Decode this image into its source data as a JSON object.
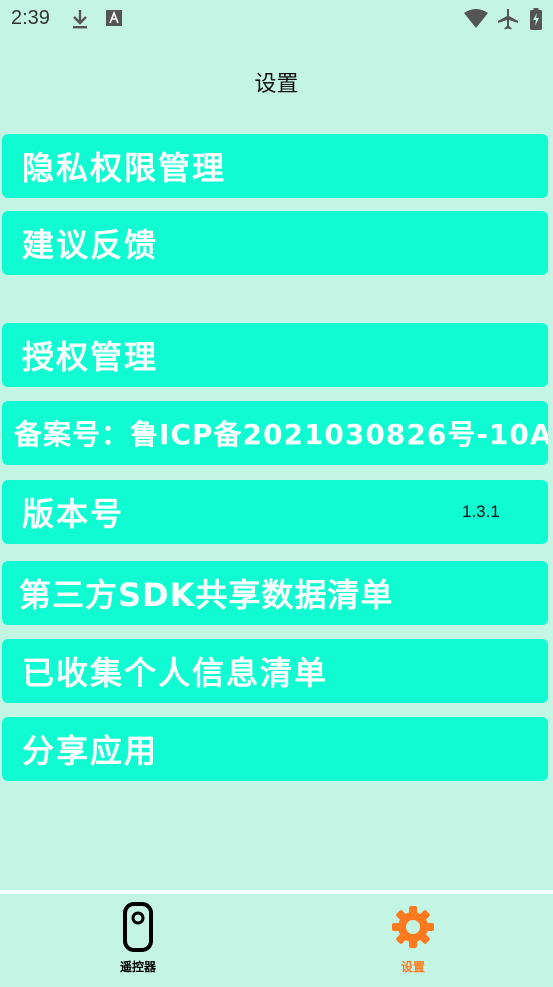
{
  "status_bar": {
    "time": "2:39"
  },
  "page": {
    "title": "设置"
  },
  "menu": {
    "privacy": "隐私权限管理",
    "feedback": "建议反馈",
    "authorization": "授权管理",
    "icp": "备案号：鲁ICP备2021030826号-10A",
    "version_label": "版本号",
    "version_value": "1.3.1",
    "third_party_sdk": "第三方SDK共享数据清单",
    "collected_info": "已收集个人信息清单",
    "share_app": "分享应用"
  },
  "bottom_nav": {
    "remote": {
      "label": "遥控器",
      "icon": "remote-control-icon",
      "color": "#000000"
    },
    "settings": {
      "label": "设置",
      "icon": "gear-icon",
      "color": "#ff7a1f"
    }
  },
  "colors": {
    "background": "#c4f4e4",
    "row": "#11fbd2",
    "accent": "#ff7a1f"
  }
}
